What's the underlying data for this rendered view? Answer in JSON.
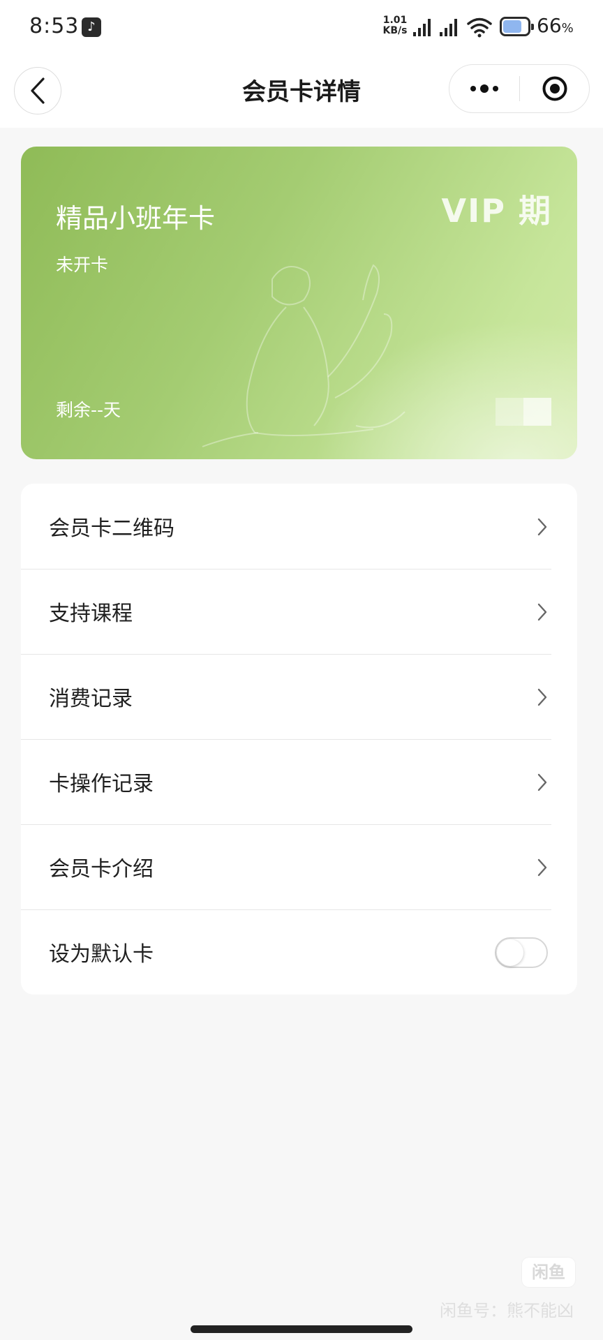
{
  "status_bar": {
    "time": "8:53",
    "net_speed_value": "1.01",
    "net_speed_unit": "KB/s",
    "battery_percent": "66",
    "battery_unit": "%"
  },
  "header": {
    "title": "会员卡详情"
  },
  "card": {
    "name": "精品小班年卡",
    "status": "未开卡",
    "remaining": "剩余--天",
    "badge": "VIP 期",
    "gradient_start": "#8fbb57",
    "gradient_end": "#d2eaa8"
  },
  "menu": {
    "items": [
      {
        "label": "会员卡二维码"
      },
      {
        "label": "支持课程"
      },
      {
        "label": "消费记录"
      },
      {
        "label": "卡操作记录"
      },
      {
        "label": "会员卡介绍"
      }
    ],
    "default_card": {
      "label": "设为默认卡",
      "enabled": false
    }
  },
  "watermark": {
    "logo": "闲鱼",
    "text": "闲鱼号：熊不能凶"
  }
}
